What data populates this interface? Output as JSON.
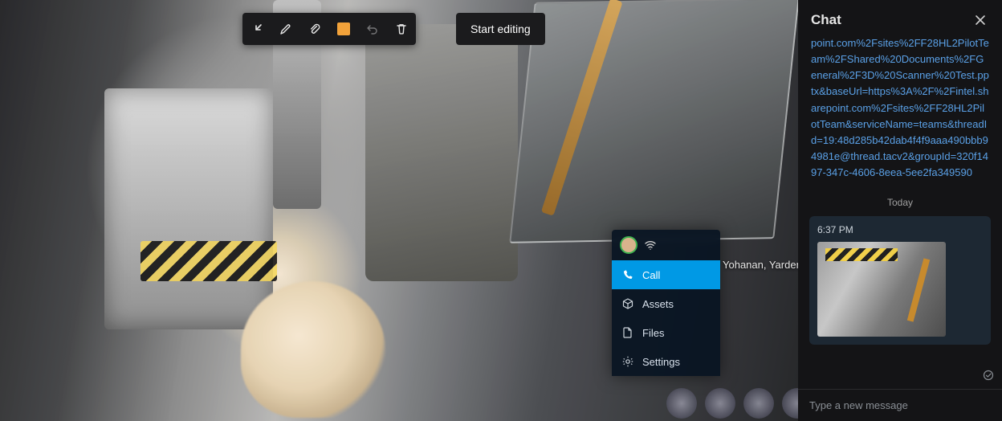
{
  "toolbar": {
    "collapse_label": "Collapse",
    "pen_label": "Pen",
    "attach_label": "Attach",
    "color_label": "Ink color",
    "undo_label": "Undo",
    "delete_label": "Delete",
    "start_editing_label": "Start editing"
  },
  "ar_panel": {
    "contact_name": "Yohanan, Yarden",
    "items": {
      "call": "Call",
      "assets": "Assets",
      "files": "Files",
      "settings": "Settings"
    }
  },
  "chat": {
    "title": "Chat",
    "long_link": "point.com%2Fsites%2FF28HL2PilotTeam%2FShared%20Documents%2FGeneral%2F3D%20Scanner%20Test.pptx&baseUrl=https%3A%2F%2Fintel.sharepoint.com%2Fsites%2FF28HL2PilotTeam&serviceName=teams&threadId=19:48d285b42dab4f4f9aaa490bbb94981e@thread.tacv2&groupId=320f1497-347c-4606-8eea-5ee2fa349590",
    "day_separator": "Today",
    "message_time": "6:37 PM",
    "input_placeholder": "Type a new message"
  }
}
